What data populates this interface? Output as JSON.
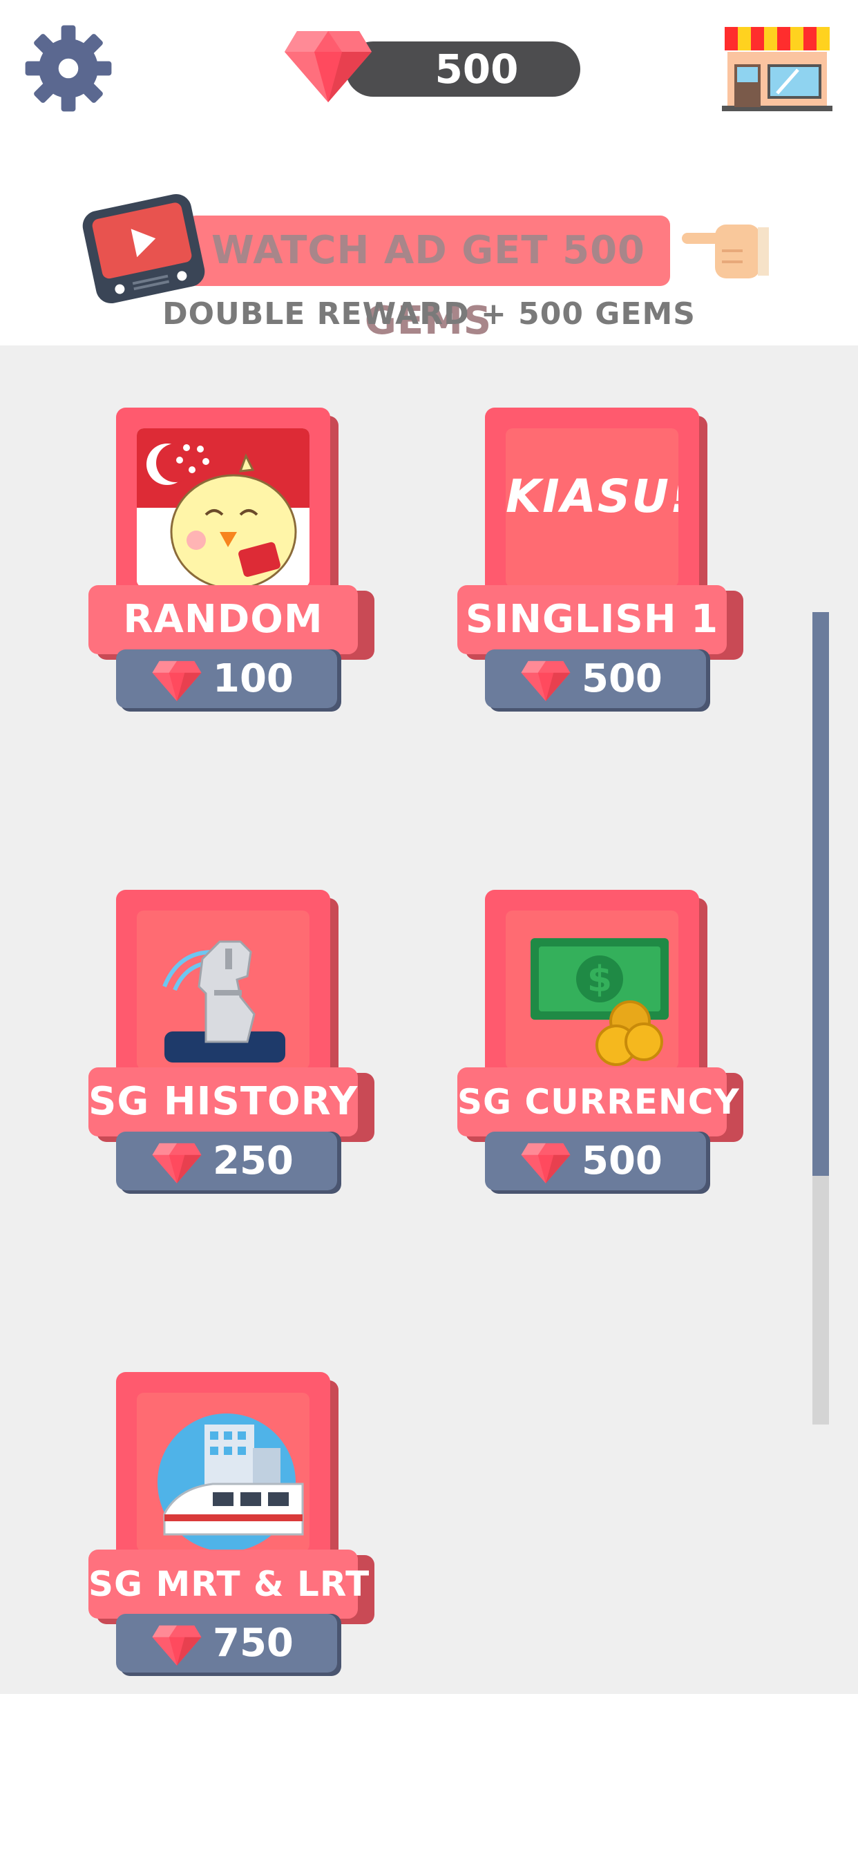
{
  "header": {
    "gem_count": "500",
    "settings_icon": "gear-icon",
    "shop_icon": "shop-icon",
    "gem_icon": "gem-icon"
  },
  "ad": {
    "button_label": "WATCH AD GET 500 GEMS",
    "subtitle": "DOUBLE REWARD + 500 GEMS",
    "tv_icon": "video-play-icon",
    "hand_icon": "pointing-hand-icon"
  },
  "categories": [
    {
      "label": "RANDOM",
      "price": "100",
      "icon": "singapore-flag-chick-icon"
    },
    {
      "label": "SINGLISH 1",
      "price": "500",
      "icon_text": "KIASU!"
    },
    {
      "label": "SG HISTORY",
      "price": "250",
      "icon": "merlion-icon"
    },
    {
      "label": "SG CURRENCY",
      "price": "500",
      "icon": "money-coins-icon"
    },
    {
      "label": "SG MRT & LRT",
      "price": "750",
      "icon": "train-icon"
    }
  ],
  "scrollbar": {
    "position": 0.0,
    "visible_fraction": 0.69
  },
  "colors": {
    "card_red": "#ff5a6e",
    "label_pink": "#ff717e",
    "price_blue": "#6b7c9c",
    "gem_red": "#ff5c6e",
    "background_grey": "#efefef"
  }
}
